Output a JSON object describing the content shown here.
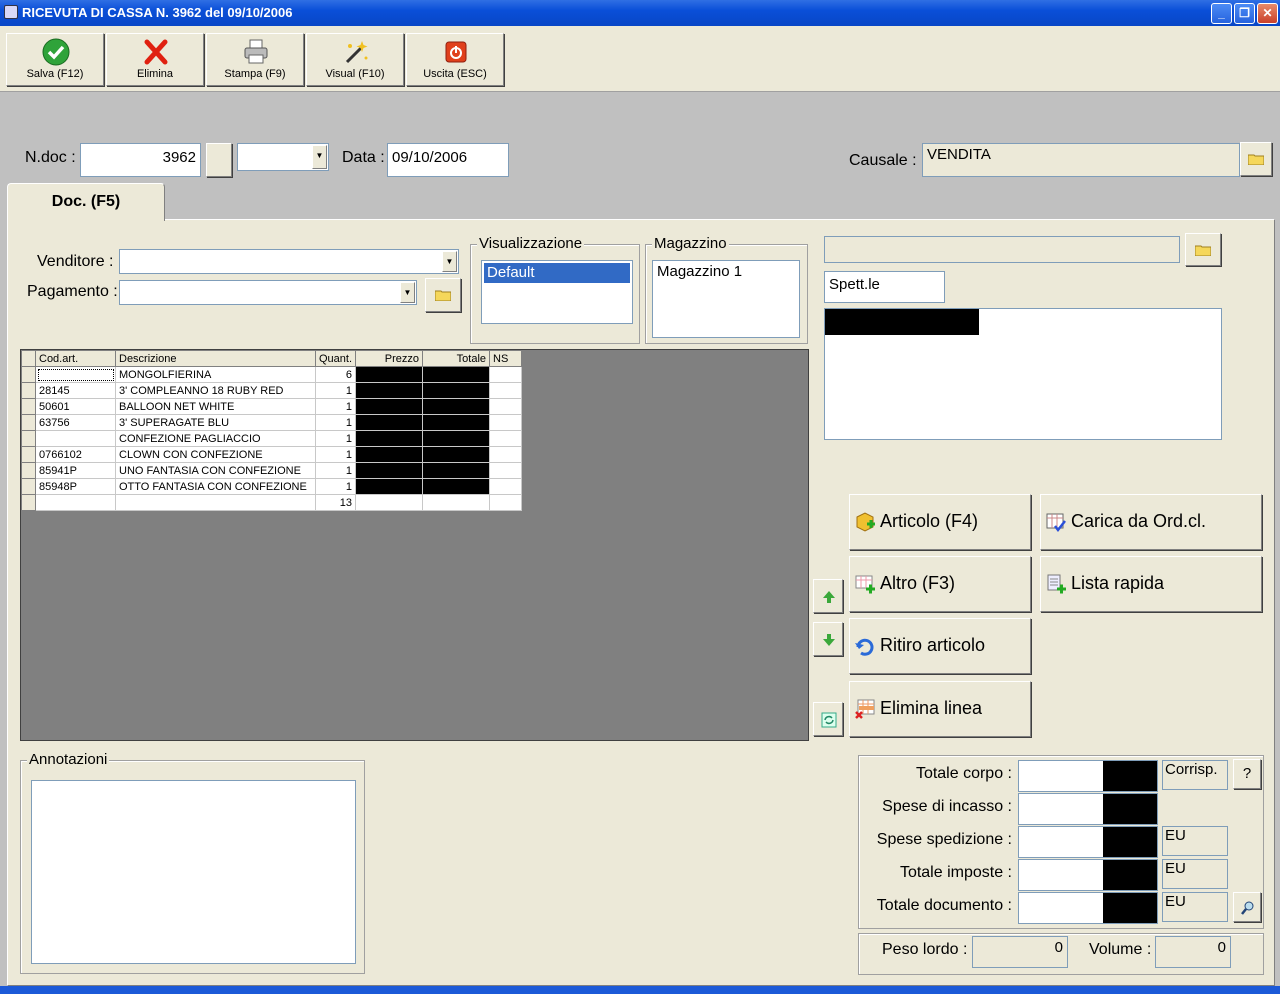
{
  "window": {
    "title": "RICEVUTA DI CASSA N.  3962  del 09/10/2006",
    "minimize": "_",
    "restore": "❐",
    "close": "✕"
  },
  "toolbar": {
    "save": "Salva (F12)",
    "delete": "Elimina",
    "print": "Stampa (F9)",
    "view": "Visual (F10)",
    "exit": "Uscita (ESC)"
  },
  "header": {
    "ndoc_label": "N.doc :",
    "ndoc_value": "3962",
    "series_value": "",
    "data_label": "Data :",
    "data_value": "09/10/2006",
    "causale_label": "Causale :",
    "causale_value": "VENDITA"
  },
  "tabs": [
    {
      "label": "Doc. (F5)"
    }
  ],
  "form": {
    "venditore_label": "Venditore :",
    "venditore_value": "",
    "pagamento_label": "Pagamento :",
    "pagamento_value": "",
    "visualizzazione_title": "Visualizzazione",
    "visualizzazione_selected": "Default",
    "magazzino_title": "Magazzino",
    "magazzino_value": "Magazzino 1",
    "customer_code": "",
    "spett": "Spett.le"
  },
  "grid": {
    "columns": [
      "Cod.art.",
      "Descrizione",
      "Quant.",
      "Prezzo",
      "Totale",
      "NS"
    ],
    "rows": [
      {
        "code": "",
        "desc": "MONGOLFIERINA",
        "qty": "6"
      },
      {
        "code": "28145",
        "desc": "3' COMPLEANNO 18 RUBY RED",
        "qty": "1"
      },
      {
        "code": "50601",
        "desc": "BALLOON NET WHITE",
        "qty": "1"
      },
      {
        "code": "63756",
        "desc": "3' SUPERAGATE BLU",
        "qty": "1"
      },
      {
        "code": "",
        "desc": "CONFEZIONE PAGLIACCIO",
        "qty": "1"
      },
      {
        "code": "0766102",
        "desc": "CLOWN CON CONFEZIONE",
        "qty": "1"
      },
      {
        "code": "85941P",
        "desc": "UNO FANTASIA CON CONFEZIONE",
        "qty": "1"
      },
      {
        "code": "85948P",
        "desc": "OTTO FANTASIA CON CONFEZIONE",
        "qty": "1"
      }
    ],
    "total_qty": "13"
  },
  "actions": {
    "articolo": "Articolo (F4)",
    "carica": "Carica da Ord.cl.",
    "altro": "Altro (F3)",
    "lista": "Lista rapida",
    "ritiro": "Ritiro articolo",
    "elimina_linea": "Elimina linea"
  },
  "annotations": {
    "title": "Annotazioni",
    "value": ""
  },
  "totals": {
    "totale_corpo": "Totale corpo :",
    "spese_incasso": "Spese di incasso :",
    "spese_spedizione": "Spese spedizione :",
    "totale_imposte": "Totale imposte :",
    "totale_documento": "Totale documento :",
    "corrisp": "Corrisp.",
    "help": "?",
    "eu": "EU"
  },
  "weights": {
    "peso_label": "Peso lordo :",
    "peso_value": "0",
    "volume_label": "Volume :",
    "volume_value": "0"
  },
  "colors": {
    "titlebar": "#0a4fd8",
    "panel": "#ece9d8",
    "selection": "#316ac5",
    "grid_bg": "#808080"
  }
}
